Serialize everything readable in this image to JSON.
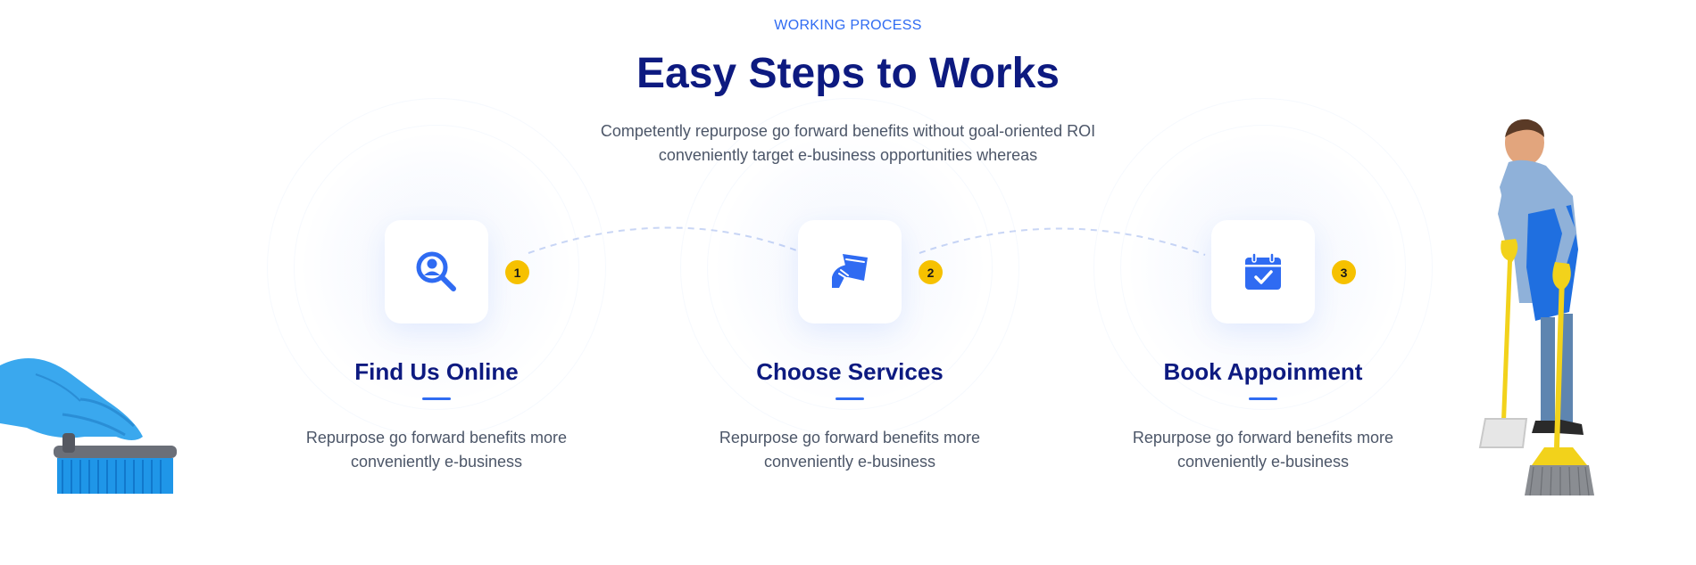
{
  "section": {
    "kicker": "WORKING PROCESS",
    "title": "Easy Steps to Works",
    "subtitle_line1": "Competently repurpose go forward benefits without goal-oriented ROI",
    "subtitle_line2": "conveniently target e-business opportunities whereas"
  },
  "steps": [
    {
      "number": "1",
      "icon": "magnifier-user-icon",
      "title": "Find Us Online",
      "desc_line1": "Repurpose go forward benefits more",
      "desc_line2": "conveniently e-business"
    },
    {
      "number": "2",
      "icon": "cleaning-cloth-hand-icon",
      "title": "Choose Services",
      "desc_line1": "Repurpose go forward benefits more",
      "desc_line2": "conveniently e-business"
    },
    {
      "number": "3",
      "icon": "calendar-check-icon",
      "title": "Book Appoinment",
      "desc_line1": "Repurpose go forward benefits more",
      "desc_line2": "conveniently e-business"
    }
  ],
  "colors": {
    "accent": "#2f6bf2",
    "heading": "#0d1a80",
    "body_text": "#4c5668",
    "badge": "#f6c100"
  }
}
